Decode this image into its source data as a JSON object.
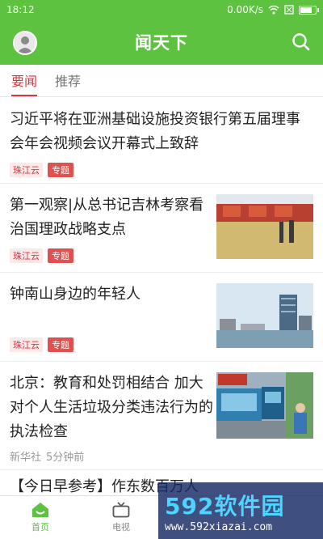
{
  "statusbar": {
    "time": "18:12",
    "speed": "0.00K/s"
  },
  "appbar": {
    "title": "闻天下"
  },
  "tabs": [
    {
      "label": "要闻"
    },
    {
      "label": "推荐"
    }
  ],
  "feed": [
    {
      "title": "习近平将在亚洲基础设施投资银行第五届理事会年会视频会议开幕式上致辞",
      "source": "珠江云",
      "topic": "专题"
    },
    {
      "title": "第一观察|从总书记吉林考察看治国理政战略支点",
      "source": "珠江云",
      "topic": "专题"
    },
    {
      "title": "钟南山身边的年轻人",
      "source": "珠江云",
      "topic": "专题"
    },
    {
      "title": "北京：教育和处罚相结合 加大对个人生活垃圾分类违法行为的执法检查",
      "source": "新华社",
      "time": "5分钟前"
    },
    {
      "title": "【今日早参考】作东数百万人"
    }
  ],
  "bottomnav": [
    {
      "label": "首页"
    },
    {
      "label": "电视"
    }
  ],
  "watermark": {
    "brand": "592软件园",
    "url": "www.592xiazai.com"
  },
  "colors": {
    "brand_green": "#5cc23f",
    "accent_red": "#d9363e"
  }
}
